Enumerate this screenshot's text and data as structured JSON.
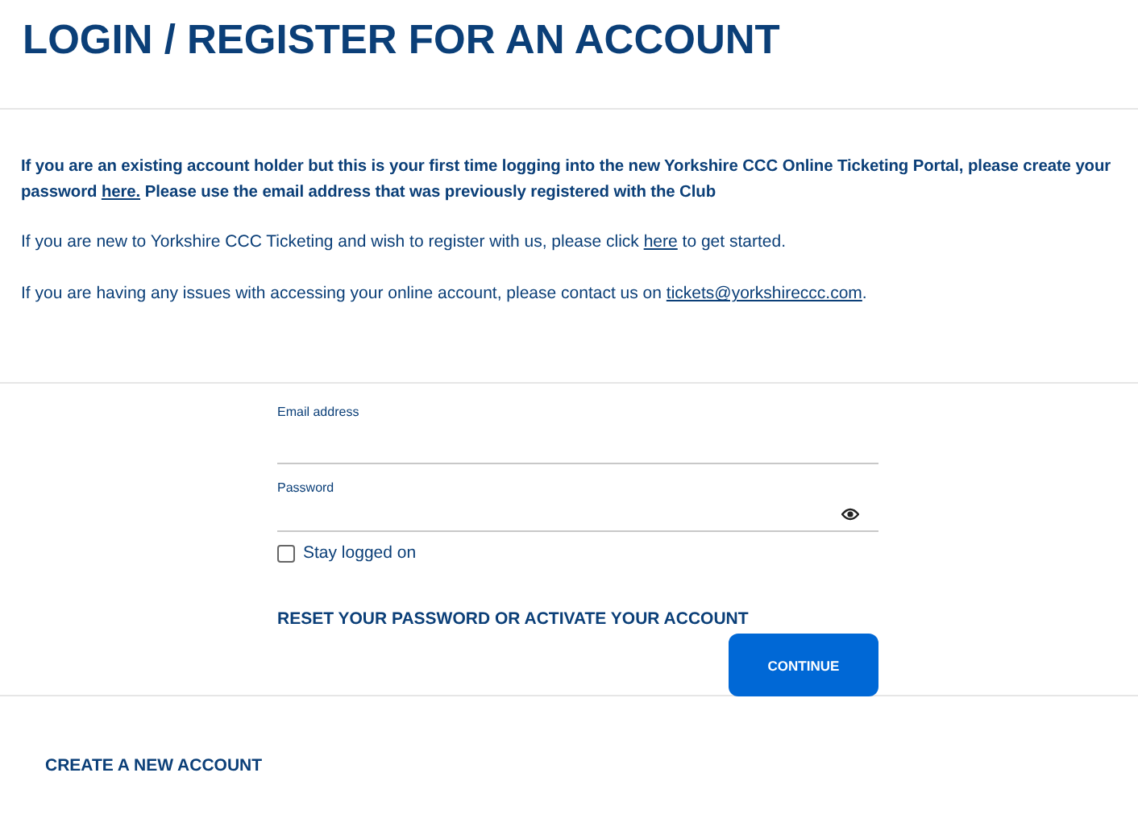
{
  "title": "LOGIN / REGISTER FOR AN ACCOUNT",
  "paragraphs": [
    {
      "bold": true,
      "before": "If you are an existing account holder but this is your first time logging into the new Yorkshire CCC Online Ticketing Portal, please create your password ",
      "link": "here.",
      "after": " Please use the email address that was previously registered with the Club"
    },
    {
      "bold": false,
      "before": "If you are new to Yorkshire CCC Ticketing and wish to register with us, please click ",
      "link": "here",
      "after": " to get started."
    },
    {
      "bold": false,
      "before": "If you are having any issues with accessing your online account, please contact us on ",
      "link": "tickets@yorkshireccc.com",
      "after": "."
    }
  ],
  "form": {
    "email_label": "Email address",
    "password_label": "Password",
    "stay_logged_on": {
      "label": "Stay logged on",
      "checked": false
    },
    "reset_link": "RESET YOUR PASSWORD OR ACTIVATE YOUR ACCOUNT",
    "continue_button": "CONTINUE"
  },
  "create_account_link": "CREATE A NEW ACCOUNT"
}
